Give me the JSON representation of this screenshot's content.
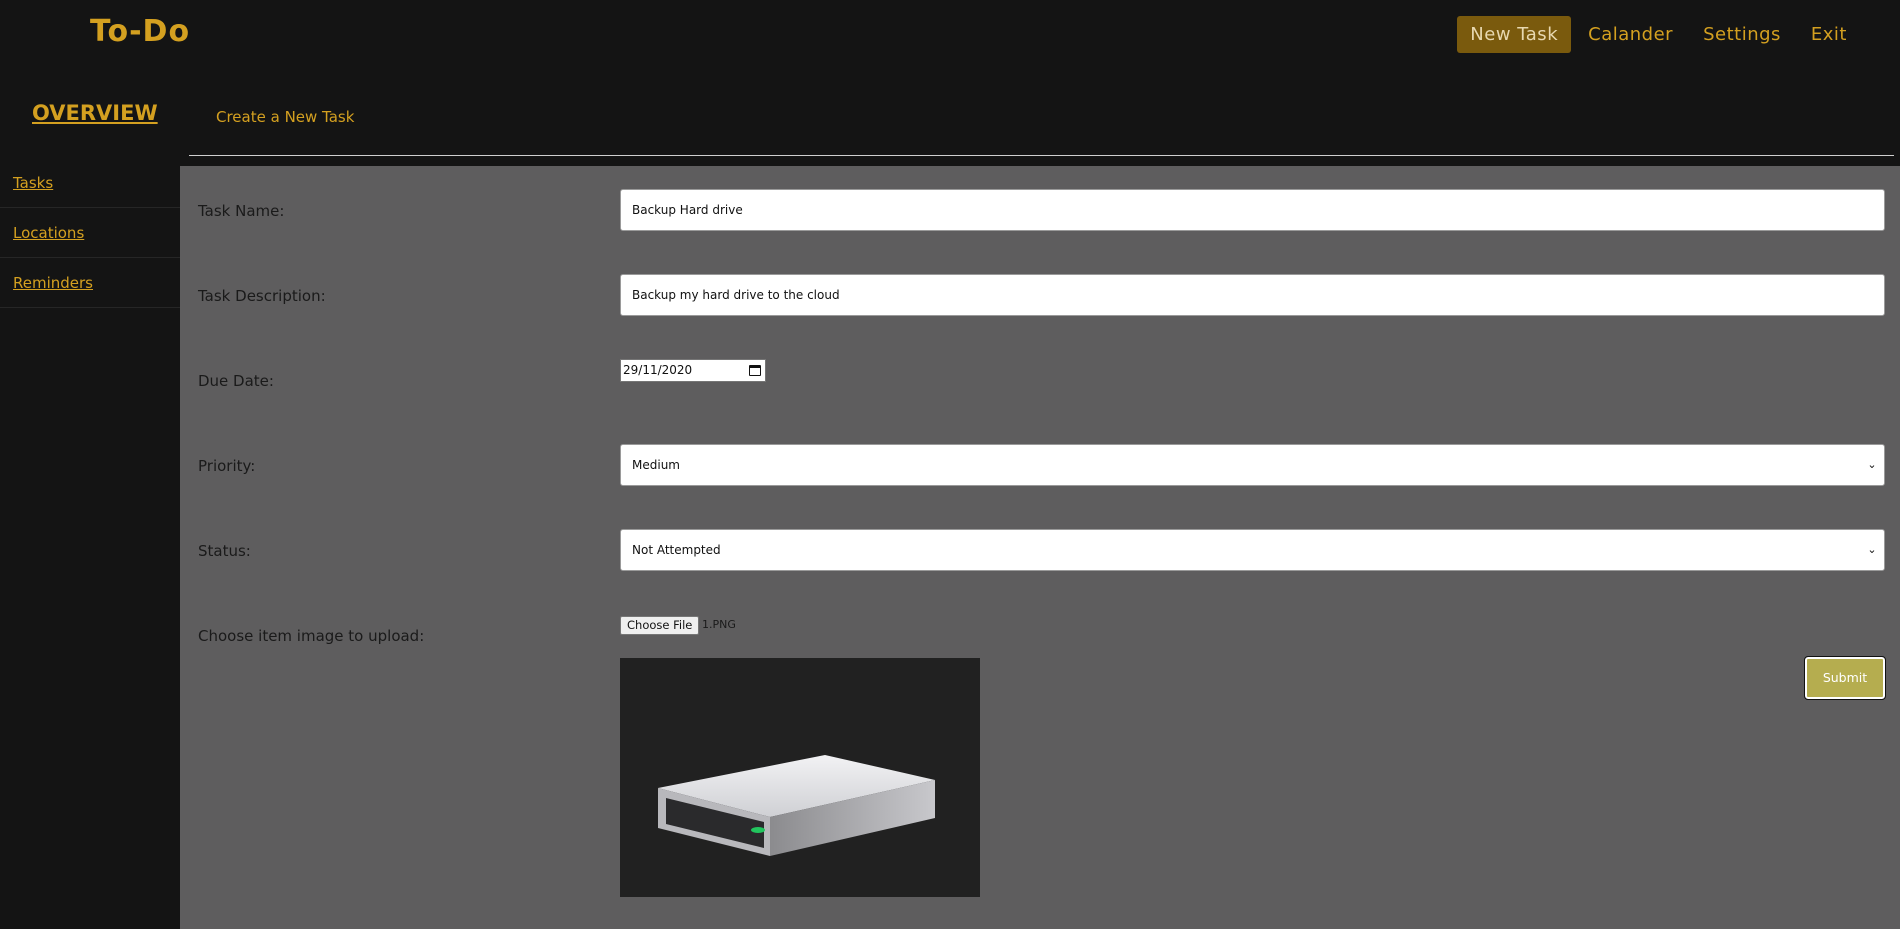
{
  "app": {
    "brand": "To-Do"
  },
  "nav": {
    "new_task": "New Task",
    "calendar": "Calander",
    "settings": "Settings",
    "exit": "Exit"
  },
  "overview": {
    "title": "OVERVIEW",
    "subtab": "Create a New Task"
  },
  "sidebar": {
    "items": [
      {
        "label": "Tasks"
      },
      {
        "label": "Locations"
      },
      {
        "label": "Reminders"
      }
    ]
  },
  "form": {
    "task_name": {
      "label": "Task Name:",
      "value": "Backup Hard drive"
    },
    "task_description": {
      "label": "Task Description:",
      "value": "Backup my hard drive to the cloud"
    },
    "due_date": {
      "label": "Due Date:",
      "value": "29/11/2020"
    },
    "priority": {
      "label": "Priority:",
      "value": "Medium"
    },
    "status": {
      "label": "Status:",
      "value": "Not Attempted"
    },
    "image": {
      "label": "Choose item image to upload:",
      "button": "Choose File",
      "file_name": "1.PNG"
    },
    "submit": "Submit"
  },
  "colors": {
    "accent": "#d4a020",
    "active_nav": "#7a5a0d",
    "background": "#141414",
    "panel": "#5e5d5e",
    "submit": "#b5ad4f"
  }
}
